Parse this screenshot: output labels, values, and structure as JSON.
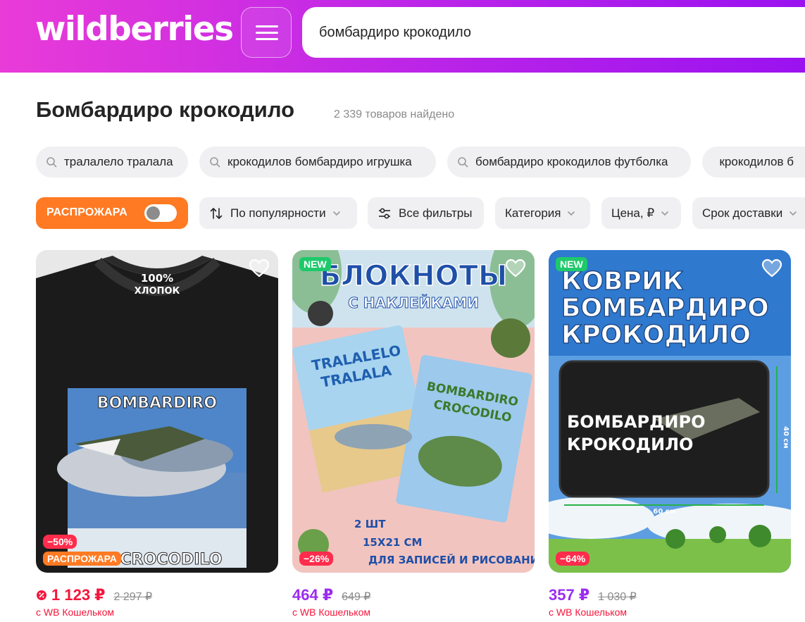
{
  "header": {
    "logo": "wildberries",
    "search_value": "бомбардиро крокодило"
  },
  "results": {
    "title": "Бомбардиро крокодило",
    "count": "2 339 товаров найдено"
  },
  "suggestions": [
    "тралалело тралала",
    "крокодилов бомбардиро игрушка",
    "бомбардиро крокодилов футболка",
    "крокодилов б"
  ],
  "filters": {
    "sale_label": "РАСПРОЖАРА",
    "sale_enabled": false,
    "sort_label": "По популярности",
    "all_filters_label": "Все фильтры",
    "category_label": "Категория",
    "price_label": "Цена, ₽",
    "delivery_label": "Срок доставки"
  },
  "products": [
    {
      "image_text_top": "100%",
      "image_text_top2": "ХЛОПОК",
      "image_text_1": "BOMBARDIRO",
      "image_text_2": "CROCODILO",
      "discount": "−50%",
      "sale_badge": "РАСПРОЖАРА",
      "price": "1 123 ₽",
      "old_price": "2 297 ₽",
      "wallet": "с WB Кошельком",
      "price_color": "#f5153b"
    },
    {
      "badge": "NEW",
      "image_text_1": "БЛОКНОТЫ",
      "image_text_2": "С НАКЛЕЙКАМИ",
      "image_text_3": "TRALALELO",
      "image_text_4": "TRALALA",
      "image_text_5": "BOMBARDIRO",
      "image_text_6": "CROCODILO",
      "image_text_7": "2 ШТ",
      "image_text_8": "15Х21 СМ",
      "image_text_9": "ДЛЯ ЗАПИСЕЙ И РИСОВАНИЯ",
      "discount": "−26%",
      "price": "464 ₽",
      "old_price": "649 ₽",
      "wallet": "с WB Кошельком",
      "price_color": "#9b2cf0"
    },
    {
      "badge": "NEW",
      "image_text_1": "КОВРИК",
      "image_text_2": "БОМБАРДИРО",
      "image_text_3": "КРОКОДИЛО",
      "image_text_4": "БОМБАРДИРО",
      "image_text_5": "КРОКОДИЛО",
      "image_text_6": "40 см",
      "image_text_7": "60 см",
      "discount": "−64%",
      "price": "357 ₽",
      "old_price": "1 030 ₽",
      "wallet": "с WB Кошельком",
      "price_color": "#9b2cf0"
    }
  ]
}
